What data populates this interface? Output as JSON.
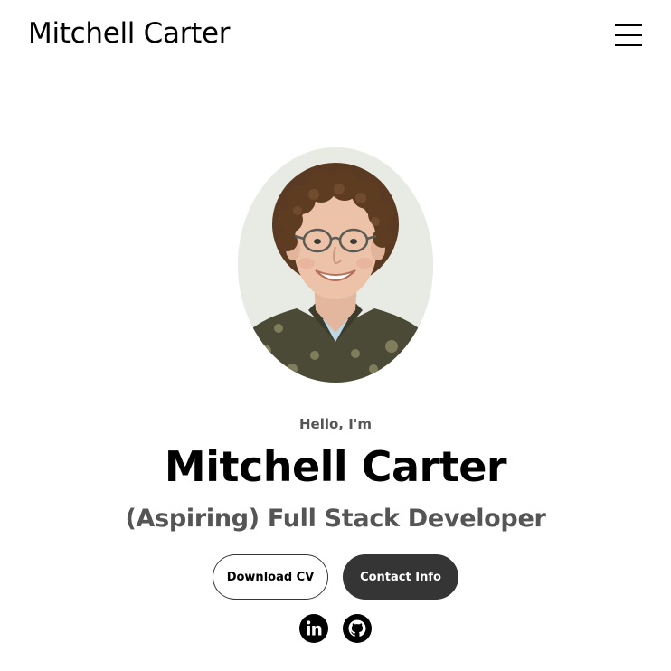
{
  "header": {
    "logo_text": "Mitchell Carter",
    "menu_icon": "hamburger-menu-icon"
  },
  "profile": {
    "avatar_alt": "profile-photo",
    "greeting": "Hello, I'm",
    "name": "Mitchell Carter",
    "role": "(Aspiring) Full Stack Developer"
  },
  "buttons": {
    "download_cv": "Download CV",
    "contact_info": "Contact Info"
  },
  "social": {
    "linkedin_icon": "linkedin-icon",
    "github_icon": "github-icon"
  },
  "colors": {
    "background": "#ffffff",
    "text": "#000000",
    "muted_text": "#555555",
    "button_dark": "#353535"
  }
}
